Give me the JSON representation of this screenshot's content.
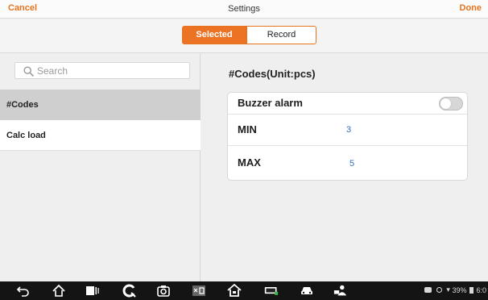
{
  "topbar": {
    "cancel": "Cancel",
    "title": "Settings",
    "done": "Done"
  },
  "segments": {
    "selected": "Selected",
    "record": "Record"
  },
  "search": {
    "placeholder": "Search"
  },
  "list": [
    {
      "label": "#Codes",
      "active": true
    },
    {
      "label": "Calc load",
      "active": false
    }
  ],
  "detail": {
    "title": "#Codes(Unit:pcs)",
    "rows": [
      {
        "label": "Buzzer alarm",
        "toggle": "off"
      },
      {
        "label": "MIN",
        "value": "3"
      },
      {
        "label": "MAX",
        "value": "5"
      }
    ]
  },
  "navbar": {
    "icons": [
      "back-icon",
      "home-icon",
      "recent-apps-icon",
      "vci-icon",
      "camera-icon",
      "screenshot-icon",
      "house-icon",
      "vci-connect-icon",
      "car-icon",
      "remote-expert-icon"
    ],
    "status": {
      "battery": "39%",
      "time": "6:0"
    }
  },
  "colors": {
    "accent": "#e8731f",
    "value_blue": "#2f6fc4",
    "navbar_bg": "#141414"
  }
}
